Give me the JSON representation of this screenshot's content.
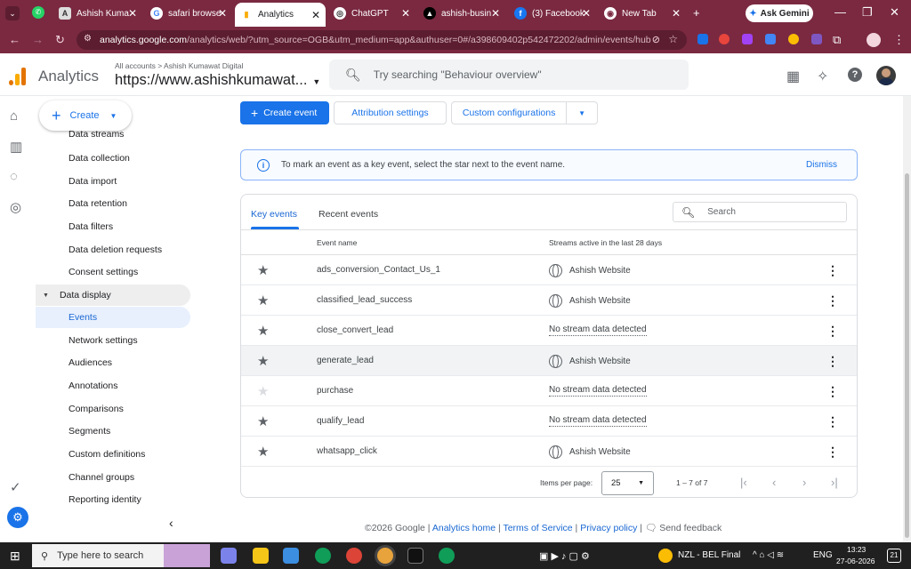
{
  "browser": {
    "tabs": [
      {
        "label": "Ashish Kuma",
        "icon": "user-icon"
      },
      {
        "label": "safari browse",
        "icon": "google-icon"
      },
      {
        "label": "Analytics",
        "icon": "analytics-icon",
        "active": true
      },
      {
        "label": "ChatGPT",
        "icon": "chatgpt-icon"
      },
      {
        "label": "ashish-busin",
        "icon": "vercel-icon"
      },
      {
        "label": "(3) Facebook",
        "icon": "facebook-icon"
      },
      {
        "label": "New Tab",
        "icon": "chrome-icon"
      }
    ],
    "gemini_label": "Ask Gemini",
    "url_host": "analytics.google.com",
    "url_path": "/analytics/web/?utm_source=OGB&utm_medium=app&authuser=0#/a398609402p542472202/admin/events/hub"
  },
  "header": {
    "app_name": "Analytics",
    "breadcrumb": "All accounts > Ashish Kumawat Digital",
    "property": "https://www.ashishkumawat...",
    "search_placeholder": "Try searching \"Behaviour overview\""
  },
  "sidebar": {
    "create_label": "Create",
    "items_top": [
      "Data streams",
      "Data collection",
      "Data import",
      "Data retention",
      "Data filters",
      "Data deletion requests",
      "Consent settings"
    ],
    "group": "Data display",
    "active_item": "Events",
    "items_bottom": [
      "Network settings",
      "Audiences",
      "Annotations",
      "Comparisons",
      "Segments",
      "Custom definitions",
      "Channel groups",
      "Reporting identity"
    ]
  },
  "toolbar": {
    "create_event": "Create event",
    "attribution": "Attribution settings",
    "custom_config": "Custom configurations"
  },
  "info_banner": {
    "text": "To mark an event as a key event, select the star next to the event name.",
    "dismiss": "Dismiss"
  },
  "events_table": {
    "tabs": [
      "Key events",
      "Recent events"
    ],
    "search_placeholder": "Search",
    "columns": [
      "Event name",
      "Streams active in the last 28 days"
    ],
    "rows": [
      {
        "name": "ads_conversion_Contact_Us_1",
        "stream": "Ashish Website",
        "has_stream": true,
        "key": true
      },
      {
        "name": "classified_lead_success",
        "stream": "Ashish Website",
        "has_stream": true,
        "key": true
      },
      {
        "name": "close_convert_lead",
        "stream": "No stream data detected",
        "has_stream": false,
        "key": true
      },
      {
        "name": "generate_lead",
        "stream": "Ashish Website",
        "has_stream": true,
        "key": true
      },
      {
        "name": "purchase",
        "stream": "No stream data detected",
        "has_stream": false,
        "key": false
      },
      {
        "name": "qualify_lead",
        "stream": "No stream data detected",
        "has_stream": false,
        "key": true
      },
      {
        "name": "whatsapp_click",
        "stream": "Ashish Website",
        "has_stream": true,
        "key": true
      }
    ],
    "items_per_page_label": "Items per page:",
    "items_per_page": "25",
    "range": "1 – 7 of 7"
  },
  "footer": {
    "copyright": "©2026 Google",
    "links": [
      "Analytics home",
      "Terms of Service",
      "Privacy policy"
    ],
    "feedback": "Send feedback"
  },
  "taskbar": {
    "search_placeholder": "Type here to search",
    "news": "NZL - BEL Final",
    "lang": "ENG",
    "time": "13:23",
    "date": "27-06-2026",
    "notif": "21"
  },
  "colors": {
    "accent": "#1a73e8",
    "chrome_frame": "#7a2941"
  }
}
